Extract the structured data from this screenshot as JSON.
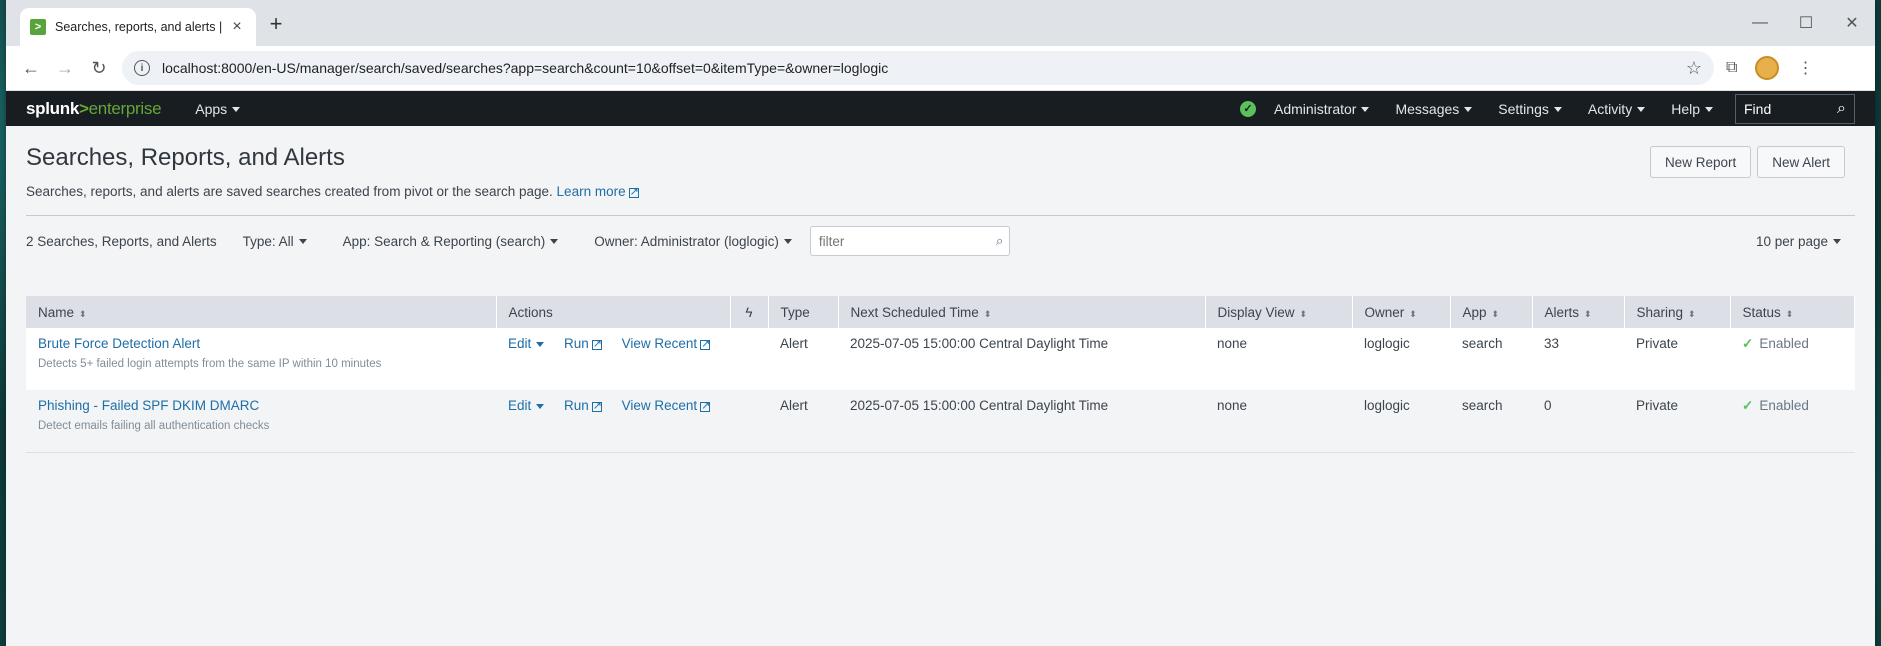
{
  "browser": {
    "tab_title": "Searches, reports, and alerts | Sp",
    "url": "localhost:8000/en-US/manager/search/saved/searches?app=search&count=10&offset=0&itemType=&owner=loglogic"
  },
  "splunk_bar": {
    "logo_left": "splunk",
    "logo_gt": ">",
    "logo_right": "enterprise",
    "apps": "Apps",
    "administrator": "Administrator",
    "messages": "Messages",
    "settings": "Settings",
    "activity": "Activity",
    "help": "Help",
    "find": "Find"
  },
  "page": {
    "title": "Searches, Reports, and Alerts",
    "description": "Searches, reports, and alerts are saved searches created from pivot or the search page.",
    "learn_more": "Learn more",
    "new_report": "New Report",
    "new_alert": "New Alert"
  },
  "filters": {
    "count": "2 Searches, Reports, and Alerts",
    "type": "Type: All",
    "app": "App: Search & Reporting (search)",
    "owner": "Owner: Administrator (loglogic)",
    "filter_placeholder": "filter",
    "per_page": "10 per page"
  },
  "table": {
    "headers": [
      "Name",
      "Actions",
      "Type",
      "Next Scheduled Time",
      "Display View",
      "Owner",
      "App",
      "Alerts",
      "Sharing",
      "Status"
    ],
    "actions": {
      "edit": "Edit",
      "run": "Run",
      "view_recent": "View Recent"
    },
    "rows": [
      {
        "name": "Brute Force Detection Alert",
        "description": "Detects 5+ failed login attempts from the same IP within 10 minutes",
        "type": "Alert",
        "next_scheduled": "2025-07-05 15:00:00 Central Daylight Time",
        "display_view": "none",
        "owner": "loglogic",
        "app": "search",
        "alerts": "33",
        "sharing": "Private",
        "status": "Enabled"
      },
      {
        "name": "Phishing - Failed SPF DKIM DMARC",
        "description": "Detect emails failing all authentication checks",
        "type": "Alert",
        "next_scheduled": "2025-07-05 15:00:00 Central Daylight Time",
        "display_view": "none",
        "owner": "loglogic",
        "app": "search",
        "alerts": "0",
        "sharing": "Private",
        "status": "Enabled"
      }
    ]
  }
}
